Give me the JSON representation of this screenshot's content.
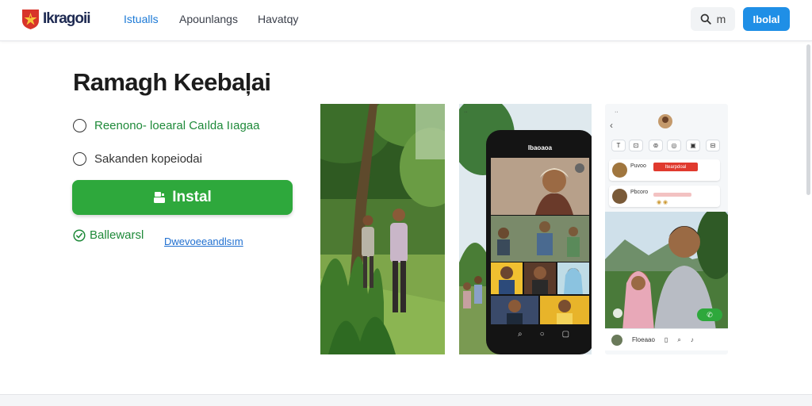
{
  "header": {
    "logo_text": "Ikragoii",
    "nav": [
      "Istualls",
      "Apounlangs",
      "Havatqy"
    ],
    "search_label": "m",
    "signin_label": "Ibolal"
  },
  "app": {
    "title": "Ramagh Keebaļai",
    "features": [
      "Reenono- loearal Caılda Iıagaa",
      "Sakanden kopeiodai"
    ],
    "install_label": "Instal",
    "verified_label": "Ballewarsl",
    "details_link": "Dwevoeeandlsım"
  },
  "screens": {
    "phone_title": "Ibaoaoa",
    "chat_names": [
      "Puvoo",
      "Pbcoro"
    ],
    "red_badge": "Itearpdoal",
    "bottom_label": "Floeaao"
  },
  "colors": {
    "primary": "#1f8fe6",
    "install": "#2ea83c",
    "accent_red": "#d03a2a"
  }
}
